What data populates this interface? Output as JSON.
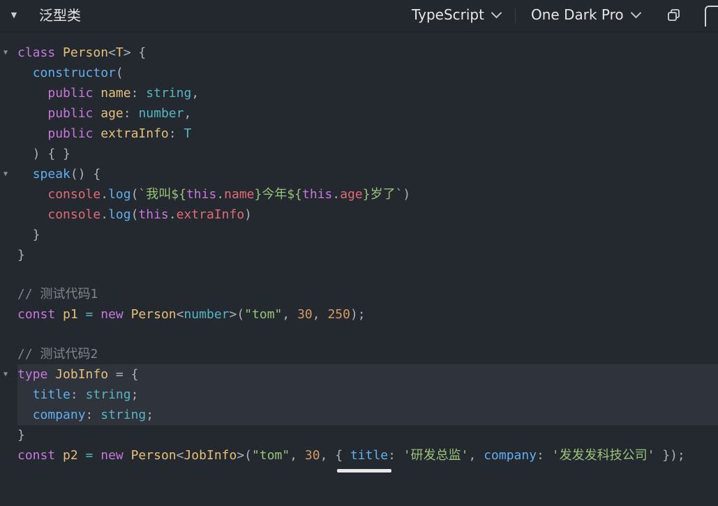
{
  "header": {
    "title": "泛型类",
    "language": "TypeScript",
    "theme": "One Dark Pro",
    "collapse_icon": "triangle-down-icon",
    "copy_icon": "copy-icon"
  },
  "colors": {
    "background": "#24282f",
    "keyword": "#c678dd",
    "class_name": "#e5c07b",
    "function": "#61afef",
    "property": "#e06c75",
    "string": "#98c379",
    "number": "#d19a66",
    "type": "#56b6c2",
    "comment": "#7f848e"
  },
  "code": {
    "l1": {
      "a": "class",
      "b": " ",
      "c": "Person",
      "d": "<",
      "e": "T",
      "f": "> {"
    },
    "l2": {
      "a": "  ",
      "b": "constructor",
      "c": "("
    },
    "l3": {
      "a": "    ",
      "b": "public",
      "c": " ",
      "d": "name",
      "e": ": ",
      "f": "string",
      "g": ","
    },
    "l4": {
      "a": "    ",
      "b": "public",
      "c": " ",
      "d": "age",
      "e": ": ",
      "f": "number",
      "g": ","
    },
    "l5": {
      "a": "    ",
      "b": "public",
      "c": " ",
      "d": "extraInfo",
      "e": ": ",
      "f": "T"
    },
    "l6": {
      "a": "  ) { }"
    },
    "l7": {
      "a": "  ",
      "b": "speak",
      "c": "() {"
    },
    "l8": {
      "a": "    ",
      "b": "console",
      "c": ".",
      "d": "log",
      "e": "(",
      "f": "`我叫${",
      "g": "this",
      "h": ".",
      "i": "name",
      "j": "}今年${",
      "k": "this",
      "l": ".",
      "m": "age",
      "n": "}岁了`",
      "o": ")"
    },
    "l9": {
      "a": "    ",
      "b": "console",
      "c": ".",
      "d": "log",
      "e": "(",
      "f": "this",
      "g": ".",
      "h": "extraInfo",
      "i": ")"
    },
    "l10": {
      "a": "  }"
    },
    "l11": {
      "a": "}"
    },
    "l12": {
      "a": "// 测试代码1"
    },
    "l13": {
      "a": "const",
      "b": " ",
      "c": "p1",
      "d": " = ",
      "e": "new",
      "f": " ",
      "g": "Person",
      "h": "<",
      "i": "number",
      "j": ">(",
      "k": "\"tom\"",
      "l": ", ",
      "m": "30",
      "n": ", ",
      "o": "250",
      "p": ");"
    },
    "l14": {
      "a": "// 测试代码2"
    },
    "l15": {
      "a": "type",
      "b": " ",
      "c": "JobInfo",
      "d": " = {"
    },
    "l16": {
      "a": "  ",
      "b": "title",
      "c": ": ",
      "d": "string",
      "e": ";"
    },
    "l17": {
      "a": "  ",
      "b": "company",
      "c": ": ",
      "d": "string",
      "e": ";"
    },
    "l18": {
      "a": "}"
    },
    "l19": {
      "a": "const",
      "b": " ",
      "c": "p2",
      "d": " = ",
      "e": "new",
      "f": " ",
      "g": "Person",
      "h": "<",
      "i": "JobInfo",
      "j": ">(",
      "k": "\"tom\"",
      "l": ", ",
      "m": "30",
      "n": ", { ",
      "o": "title",
      "p": ": ",
      "q": "'研发总监'",
      "r": ", ",
      "s": "company",
      "t": ": ",
      "u": "'发发发科技公司'",
      "v": " });"
    }
  }
}
